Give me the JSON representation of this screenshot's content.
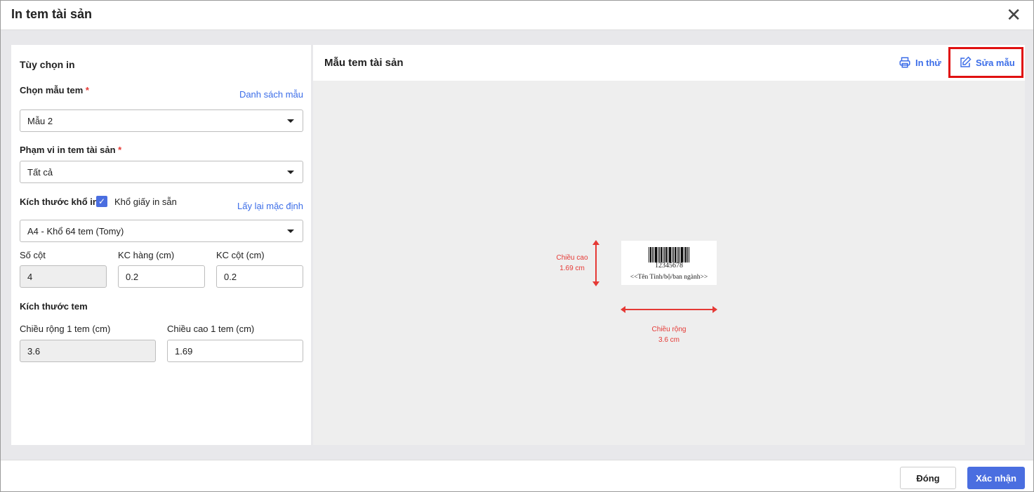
{
  "dialog": {
    "title": "In tem tài sản"
  },
  "left": {
    "title": "Tùy chọn in",
    "template_label": "Chọn mẫu tem",
    "template_list_link": "Danh sách mẫu",
    "template_value": "Mẫu 2",
    "scope_label": "Phạm vi in tem tài sản",
    "scope_value": "Tất cả",
    "req": "*",
    "paper_label": "Kích thước khổ in",
    "paper_checkbox_label": "Khổ giấy in sẵn",
    "reset_link": "Lấy lại mặc định",
    "paper_value": "A4 - Khổ 64 tem (Tomy)",
    "cols_label": "Số cột",
    "cols_value": "4",
    "row_gap_label": "KC hàng (cm)",
    "row_gap_value": "0.2",
    "col_gap_label": "KC cột (cm)",
    "col_gap_value": "0.2",
    "label_size_title": "Kích thước tem",
    "width_label": "Chiều rộng 1 tem (cm)",
    "width_value": "3.6",
    "height_label": "Chiều cao 1 tem (cm)",
    "height_value": "1.69"
  },
  "right": {
    "title": "Mẫu tem tài sản",
    "print_test": "In thử",
    "edit_template": "Sửa mẫu",
    "barcode_number": "12345678",
    "label_text": "<<Tên Tỉnh/bộ/ban ngành>>",
    "height_caption": "Chiều cao",
    "height_dim": "1.69 cm",
    "width_caption": "Chiều rộng",
    "width_dim": "3.6 cm"
  },
  "footer": {
    "close": "Đóng",
    "confirm": "Xác nhận"
  },
  "colors": {
    "accent": "#3b6de8",
    "highlight": "#e01010",
    "dimension": "#e53935"
  }
}
